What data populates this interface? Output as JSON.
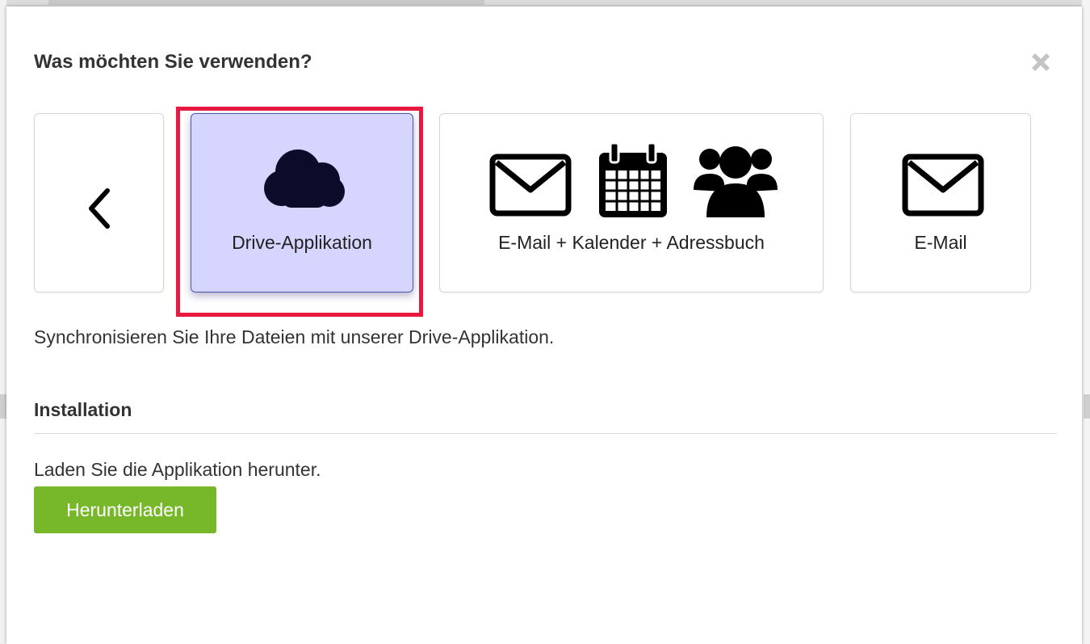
{
  "modal": {
    "title": "Was möchten Sie verwenden?",
    "close_icon": "close-icon"
  },
  "options": {
    "prev_icon": "chevron-left-icon",
    "drive": {
      "label": "Drive-Applikation",
      "icon": "cloud-icon",
      "selected": true
    },
    "full": {
      "label": "E-Mail + Kalender + Adressbuch",
      "icons": [
        "envelope-icon",
        "calendar-icon",
        "users-icon"
      ]
    },
    "mail": {
      "label": "E-Mail",
      "icon": "envelope-icon"
    }
  },
  "description": "Synchronisieren Sie Ihre Dateien mit unserer Drive-Applikation.",
  "installation": {
    "title": "Installation",
    "step_text": "Laden Sie die Applikation herunter.",
    "button_label": "Herunterladen"
  },
  "colors": {
    "selected_bg": "#d6d5ff",
    "highlight_border": "#e8193f",
    "button_green": "#77b82a",
    "icon_dark": "#0b0b2a"
  }
}
